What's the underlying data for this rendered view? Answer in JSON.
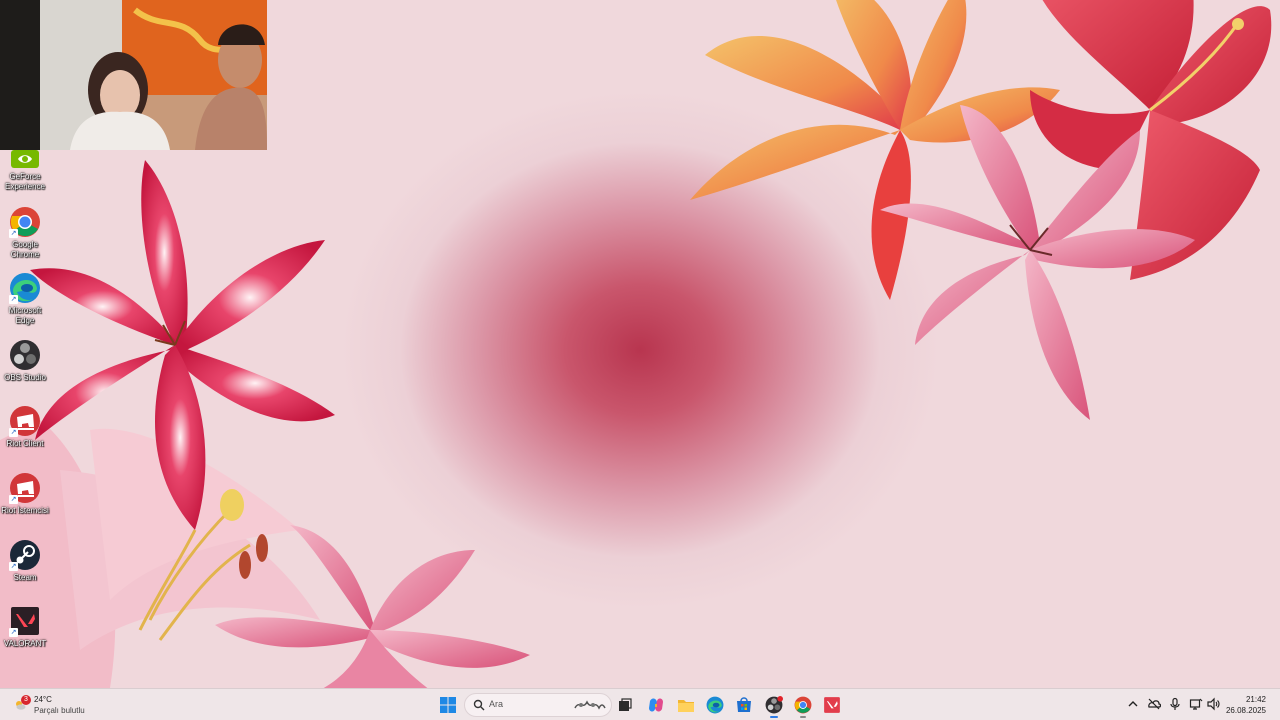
{
  "desktop": {
    "icons": [
      {
        "label": "GeForce Experience",
        "icon": "geforce-experience-icon"
      },
      {
        "label": "Google Chrome",
        "icon": "chrome-icon"
      },
      {
        "label": "Microsoft Edge",
        "icon": "edge-icon"
      },
      {
        "label": "OBS Studio",
        "icon": "obs-studio-icon"
      },
      {
        "label": "Riot Client",
        "icon": "riot-client-icon"
      },
      {
        "label": "Riot İstemcisi",
        "icon": "riot-istemcisi-icon"
      },
      {
        "label": "Steam",
        "icon": "steam-icon"
      },
      {
        "label": "VALORANT",
        "icon": "valorant-icon"
      }
    ]
  },
  "taskbar": {
    "weather": {
      "temperature": "24°C",
      "condition": "Parçalı bulutlu",
      "badge": "3"
    },
    "search_placeholder": "Ara",
    "apps": [
      "start-icon",
      "task-view-icon",
      "copilot-icon",
      "file-explorer-icon",
      "edge-icon",
      "microsoft-store-icon",
      "obs-studio-icon",
      "chrome-icon",
      "valorant-icon"
    ],
    "clock": {
      "time": "21:42",
      "date": "26.08.2025"
    }
  },
  "colors": {
    "accent_red": "#c9374f",
    "taskbar_bg": "#efe6e8",
    "wallpaper_bg": "#ecd2d8"
  }
}
